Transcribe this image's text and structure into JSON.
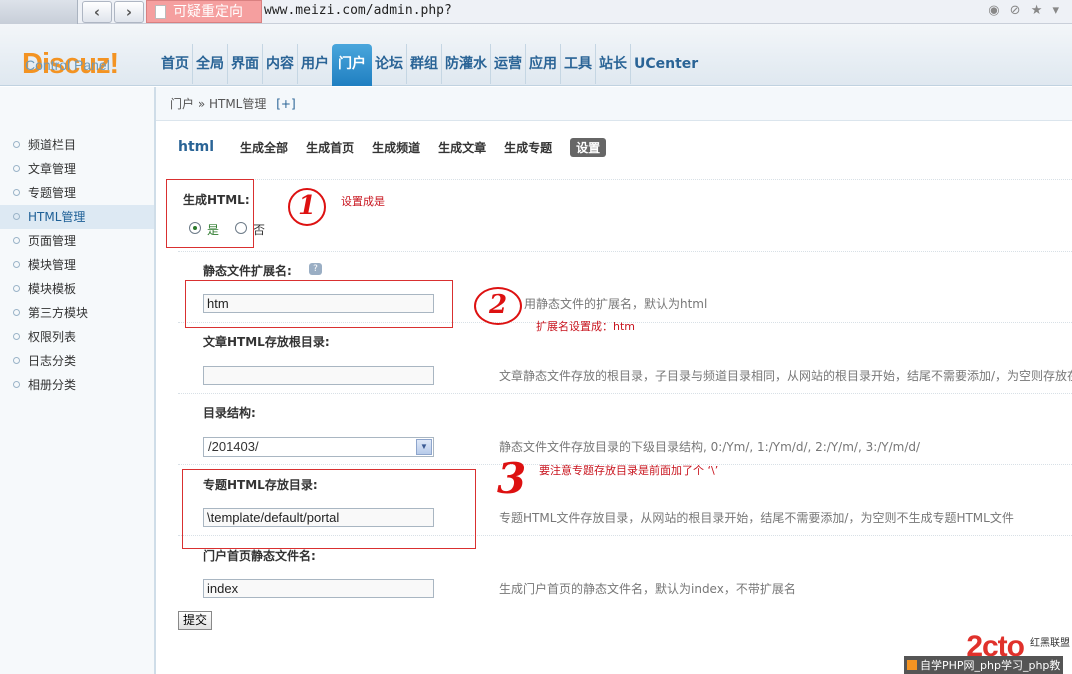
{
  "browser": {
    "redirect_label": "可疑重定向",
    "url": "www.meizi.com/admin.php?"
  },
  "brand": {
    "name": "Discuz!",
    "subtitle": "Control Panel"
  },
  "mainnav": [
    "首页",
    "全局",
    "界面",
    "内容",
    "用户",
    "门户",
    "论坛",
    "群组",
    "防灌水",
    "运营",
    "应用",
    "工具",
    "站长",
    "UCenter"
  ],
  "breadcrumb": {
    "text": "门户 » HTML管理",
    "plus": "[+]"
  },
  "sidebar": [
    "频道栏目",
    "文章管理",
    "专题管理",
    "HTML管理",
    "页面管理",
    "模块管理",
    "模块模板",
    "第三方模块",
    "权限列表",
    "日志分类",
    "相册分类"
  ],
  "tabs": {
    "title": "html",
    "items": [
      "生成全部",
      "生成首页",
      "生成频道",
      "生成文章",
      "生成专题",
      "设置"
    ]
  },
  "form": {
    "gen_html_label": "生成HTML:",
    "yes": "是",
    "no": "否",
    "ext_label": "静态文件扩展名:",
    "ext_value": "htm",
    "ext_tip": "用静态文件的扩展名，默认为html",
    "article_dir_label": "文章HTML存放根目录:",
    "article_dir_value": "",
    "article_dir_tip": "文章静态文件存放的根目录，子目录与频道目录相同，从网站的根目录开始，结尾不需要添加/，为空则存放在",
    "dir_struct_label": "目录结构:",
    "dir_struct_value": "/201403/",
    "dir_struct_tip": "静态文件文件存放目录的下级目录结构, 0:/Ym/, 1:/Ym/d/, 2:/Y/m/, 3:/Y/m/d/",
    "topic_dir_label": "专题HTML存放目录:",
    "topic_dir_value": "\\template/default/portal",
    "topic_dir_tip": "专题HTML文件存放目录，从网站的根目录开始，结尾不需要添加/，为空则不生成专题HTML文件",
    "index_label": "门户首页静态文件名:",
    "index_value": "index",
    "index_tip": "生成门户首页的静态文件名，默认为index，不带扩展名",
    "submit": "提交"
  },
  "annotations": {
    "n1": "1",
    "n2": "2",
    "n3": "3",
    "note1": "设置成是",
    "note2": "扩展名设置成：htm",
    "note3": "要注意专题存放目录是前面加了个 ‘\\’"
  },
  "watermark": {
    "logo": "2cto",
    "logo_sub": "红黑联盟",
    "text": "自学PHP网_php学习_php教"
  }
}
